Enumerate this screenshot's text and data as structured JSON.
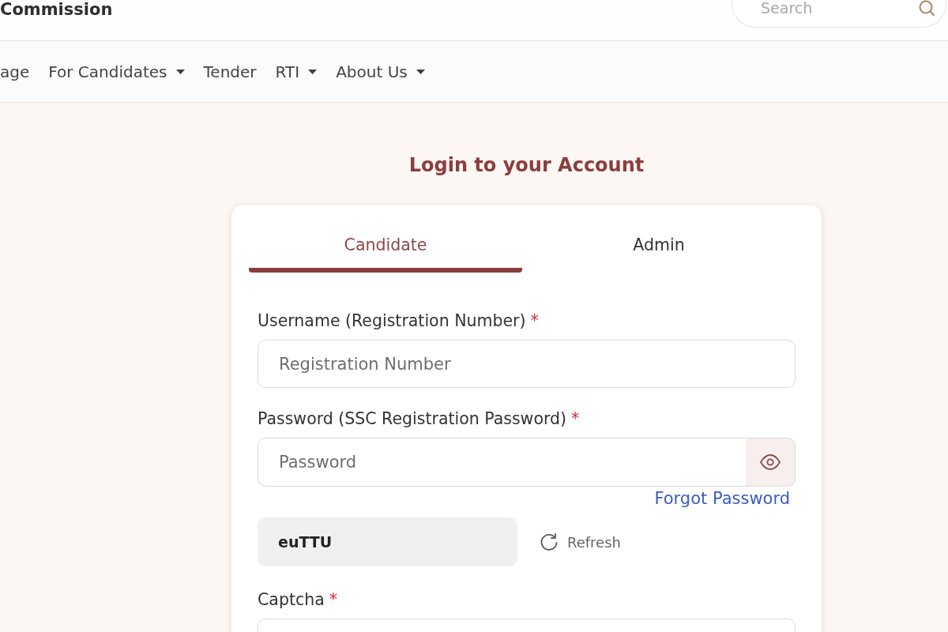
{
  "header": {
    "title": "Commission",
    "search": {
      "placeholder": "Search"
    }
  },
  "nav": [
    {
      "label": "age",
      "dropdown": false
    },
    {
      "label": "For Candidates",
      "dropdown": true
    },
    {
      "label": "Tender",
      "dropdown": false
    },
    {
      "label": "RTI",
      "dropdown": true
    },
    {
      "label": "About Us",
      "dropdown": true
    }
  ],
  "login": {
    "title": "Login to your Account",
    "tabs": [
      {
        "label": "Candidate",
        "selected": true
      },
      {
        "label": "Admin",
        "selected": false
      }
    ],
    "fields": [
      {
        "kind": "text",
        "label": "Username (Registration Number)",
        "required_mark": "*",
        "placeholder": "Registration Number"
      },
      {
        "kind": "password",
        "label": "Password (SSC Registration Password)",
        "required_mark": "*",
        "placeholder": "Password",
        "link": "Forgot Password"
      },
      {
        "kind": "captcha",
        "code": "euTTU",
        "action": "Refresh"
      },
      {
        "kind": "text",
        "label": "Captcha",
        "required_mark": "*"
      }
    ]
  }
}
